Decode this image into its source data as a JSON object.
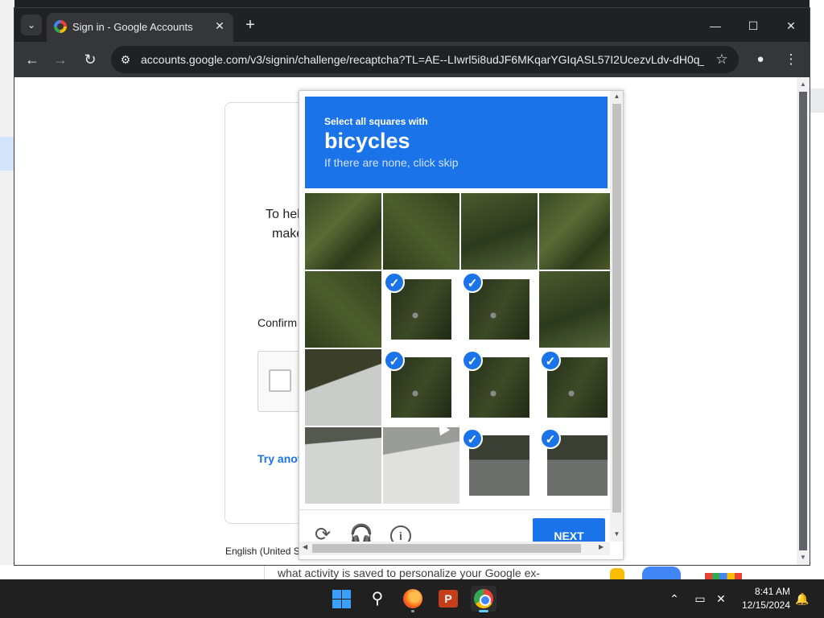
{
  "browser": {
    "tab_title": "Sign in - Google Accounts",
    "url": "accounts.google.com/v3/signin/challenge/recaptcha?TL=AE--LIwrl5i8udJF6MKqarYGIqASL57I2UcezvLdv-dH0q_..."
  },
  "signin_card": {
    "line1": "To hel",
    "line2": "make",
    "confirm": "Confirm",
    "try_another": "Try anot",
    "footer_lang": "English (United S"
  },
  "background_page": {
    "bottom_text": "what activity is saved to personalize your Google ex-"
  },
  "captcha": {
    "instruction": "Select all squares with",
    "target": "bicycles",
    "hint": "If there are none, click skip",
    "next_label": "NEXT",
    "tiles": [
      {
        "selected": false
      },
      {
        "selected": false
      },
      {
        "selected": false
      },
      {
        "selected": false
      },
      {
        "selected": false
      },
      {
        "selected": true
      },
      {
        "selected": true
      },
      {
        "selected": false
      },
      {
        "selected": false
      },
      {
        "selected": true
      },
      {
        "selected": true
      },
      {
        "selected": true
      },
      {
        "selected": false
      },
      {
        "selected": false
      },
      {
        "selected": true
      },
      {
        "selected": true
      }
    ]
  },
  "taskbar": {
    "time": "8:41 AM",
    "date": "12/15/2024"
  },
  "icons": {
    "back": "arrow-left-icon",
    "forward": "arrow-right-icon",
    "reload": "reload-icon",
    "star": "star-icon",
    "profile": "profile-icon",
    "menu": "kebab-menu-icon"
  },
  "colors": {
    "captcha_blue": "#1a73e8",
    "chrome_dark": "#202124"
  }
}
